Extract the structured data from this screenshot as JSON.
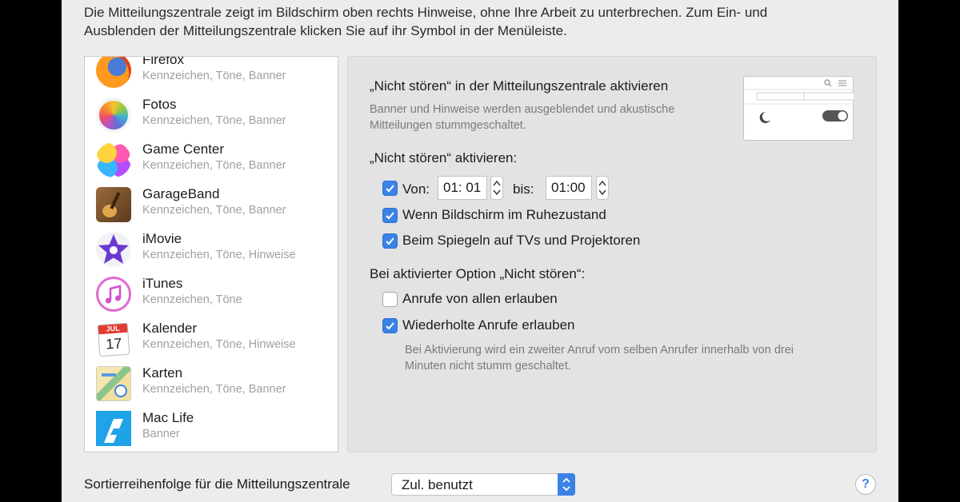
{
  "intro": {
    "line1": "Die Mitteilungszentrale zeigt im Bildschirm oben rechts Hinweise, ohne Ihre Arbeit zu unterbrechen. Zum Ein- und",
    "line2": "Ausblenden der Mitteilungszentrale klicken Sie auf ihr Symbol in der Menüleiste."
  },
  "apps": [
    {
      "name": "Firefox",
      "sub": "Kennzeichen, Töne, Banner",
      "icon": "firefox-icon"
    },
    {
      "name": "Fotos",
      "sub": "Kennzeichen, Töne, Banner",
      "icon": "photos-icon"
    },
    {
      "name": "Game Center",
      "sub": "Kennzeichen, Töne, Banner",
      "icon": "game-center-icon"
    },
    {
      "name": "GarageBand",
      "sub": "Kennzeichen, Töne, Banner",
      "icon": "garageband-icon"
    },
    {
      "name": "iMovie",
      "sub": "Kennzeichen, Töne, Hinweise",
      "icon": "imovie-icon"
    },
    {
      "name": "iTunes",
      "sub": "Kennzeichen, Töne",
      "icon": "itunes-icon"
    },
    {
      "name": "Kalender",
      "sub": "Kennzeichen, Töne, Hinweise",
      "icon": "calendar-icon",
      "calendar_month": "JUL",
      "calendar_day": "17"
    },
    {
      "name": "Karten",
      "sub": "Kennzeichen, Töne, Banner",
      "icon": "maps-icon"
    },
    {
      "name": "Mac Life",
      "sub": "Banner",
      "icon": "mac-life-icon"
    }
  ],
  "dnd": {
    "title": "„Nicht stören“ in der Mitteilungszentrale aktivieren",
    "description_line1": "Banner und Hinweise werden ausgeblendet und akustische",
    "description_line2": "Mitteilungen stummgeschaltet.",
    "activate_heading": "„Nicht stören“ aktivieren:",
    "from_label": "Von:",
    "from_time": "01: 01",
    "to_label": "bis:",
    "to_time": "01:00",
    "from_checked": true,
    "sleep_label": "Wenn Bildschirm im Ruhezustand",
    "sleep_checked": true,
    "mirror_label": "Beim Spiegeln auf TVs und Projektoren",
    "mirror_checked": true,
    "option_heading": "Bei aktivierter Option „Nicht stören“:",
    "calls_all_label": "Anrufe von allen erlauben",
    "calls_all_checked": false,
    "repeat_calls_label": "Wiederholte Anrufe erlauben",
    "repeat_calls_checked": true,
    "repeat_desc_line1": "Bei Aktivierung wird ein zweiter Anruf vom selben Anrufer innerhalb von drei",
    "repeat_desc_line2": "Minuten nicht stumm geschaltet."
  },
  "footer": {
    "sort_label": "Sortierreihenfolge für die Mitteilungszentrale",
    "sort_value": "Zul. benutzt",
    "help": "?"
  },
  "colors": {
    "accent": "#3b82e6",
    "window_bg": "#ececec",
    "panel_bg": "#e3e3e3",
    "secondary_text": "#a0a0a0"
  }
}
